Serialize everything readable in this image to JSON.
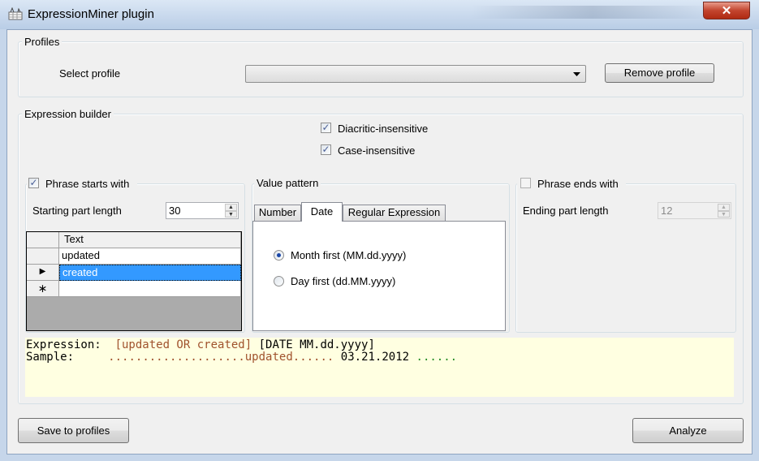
{
  "window": {
    "title": "ExpressionMiner plugin",
    "close_glyph": "✕"
  },
  "profiles": {
    "group_label": "Profiles",
    "select_label": "Select profile",
    "select_value": "",
    "remove_button": "Remove profile"
  },
  "builder": {
    "group_label": "Expression builder",
    "diacritic": {
      "label": "Diacritic-insensitive",
      "checked": true
    },
    "case": {
      "label": "Case-insensitive",
      "checked": true
    }
  },
  "starts": {
    "checkbox_label": "Phrase starts with",
    "checked": true,
    "length_label": "Starting part length",
    "length_value": "30",
    "grid": {
      "column": "Text",
      "rows": [
        "updated",
        "created",
        ""
      ],
      "selected_row": 1
    },
    "new_row_glyph": "∗",
    "current_row_glyph": "▶"
  },
  "pattern": {
    "group_label": "Value pattern",
    "tabs": [
      "Number",
      "Date",
      "Regular Expression"
    ],
    "active_tab": 1,
    "options": [
      {
        "label": "Month first (MM.dd.yyyy)",
        "selected": true
      },
      {
        "label": "Day first (dd.MM.yyyy)",
        "selected": false
      }
    ]
  },
  "ends": {
    "checkbox_label": "Phrase ends with",
    "checked": false,
    "length_label": "Ending part length",
    "length_value": "12"
  },
  "preview": {
    "expression_label": "Expression:",
    "expression_phrase": "[updated OR created]",
    "expression_pattern": "[DATE MM.dd.yyyy]",
    "sample_label": "Sample:",
    "sample_dots_start": "....................",
    "sample_word": "updated",
    "sample_dots_mid": "......",
    "sample_value": "03.21.2012",
    "sample_dots_end": "......",
    "colors": {
      "phrase": "#a0522d",
      "value": "#000000",
      "trail": "#228b22",
      "background": "#ffffe1"
    }
  },
  "footer": {
    "save_button": "Save to profiles",
    "analyze_button": "Analyze"
  }
}
